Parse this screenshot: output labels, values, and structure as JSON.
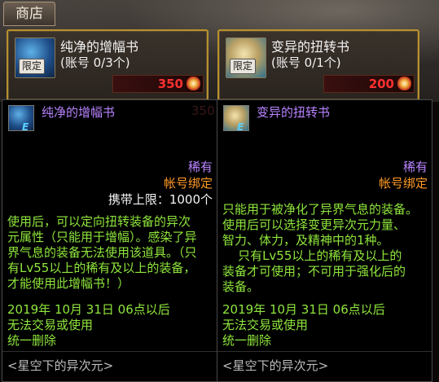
{
  "shop": {
    "tab_label": "商店",
    "items": [
      {
        "name": "纯净的增幅书",
        "quantity": "(账号 0/3个)",
        "badge": "限定",
        "price": "350",
        "icon": "blue-scroll-icon"
      },
      {
        "name": "变异的扭转书",
        "quantity": "(账号 0/1个)",
        "badge": "限定",
        "price": "200",
        "icon": "tan-scroll-icon"
      }
    ],
    "currency_icon": "sparkle-coin-icon",
    "price_color": "#ff3030",
    "border_color": "#b8912e"
  },
  "tooltips": [
    {
      "name": "纯净的增幅书",
      "e_mark": "E",
      "ghost_price": "350",
      "rarity": "稀有",
      "binding": "帐号绑定",
      "carry_limit": "携带上限：1000个",
      "description": "使用后，可以定向扭转装备的异次\n元属性（只能用于增幅）。感染了异\n界气息的装备无法使用该道具。（只\n有Lv55以上的稀有及以上的装备，\n才能使用此增幅书！）",
      "date_lines": "2019年 10月 31日 06点以后\n无法交易或使用\n统一删除",
      "set_name": "<星空下的异次元>"
    },
    {
      "name": "变异的扭转书",
      "e_mark": "E",
      "rarity": "稀有",
      "binding": "帐号绑定",
      "description": "只能用于被净化了异界气息的装备。\n使用后可以选择变更异次元力量、\n智力、体力，及精神中的1种。\n    只有Lv55以上的稀有及以上的\n装备才可使用；不可用于强化后的\n装备。",
      "date_lines": "2019年 10月 31日 06点以后\n无法交易或使用\n统一删除",
      "set_name": "<星空下的异次元>"
    }
  ],
  "colors": {
    "item_name": "#b884ff",
    "rarity": "#b884ff",
    "binding": "#ff9a26",
    "description": "#8fe63c",
    "set_name": "#bdbdbd"
  }
}
